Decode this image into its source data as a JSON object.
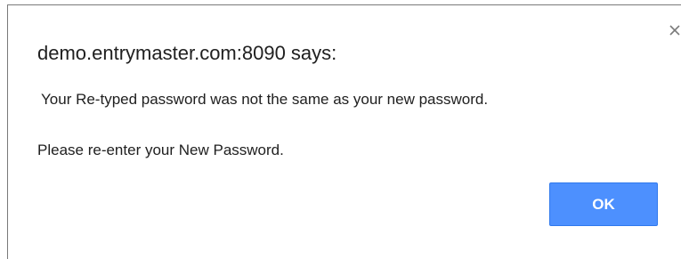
{
  "dialog": {
    "title": "demo.entrymaster.com:8090 says:",
    "message_line1": "Your Re-typed password was not the same as your new password.",
    "message_line2": "Please re-enter your New Password.",
    "ok_label": "OK",
    "close_icon": "close-icon",
    "accent_color": "#4d90fe"
  }
}
